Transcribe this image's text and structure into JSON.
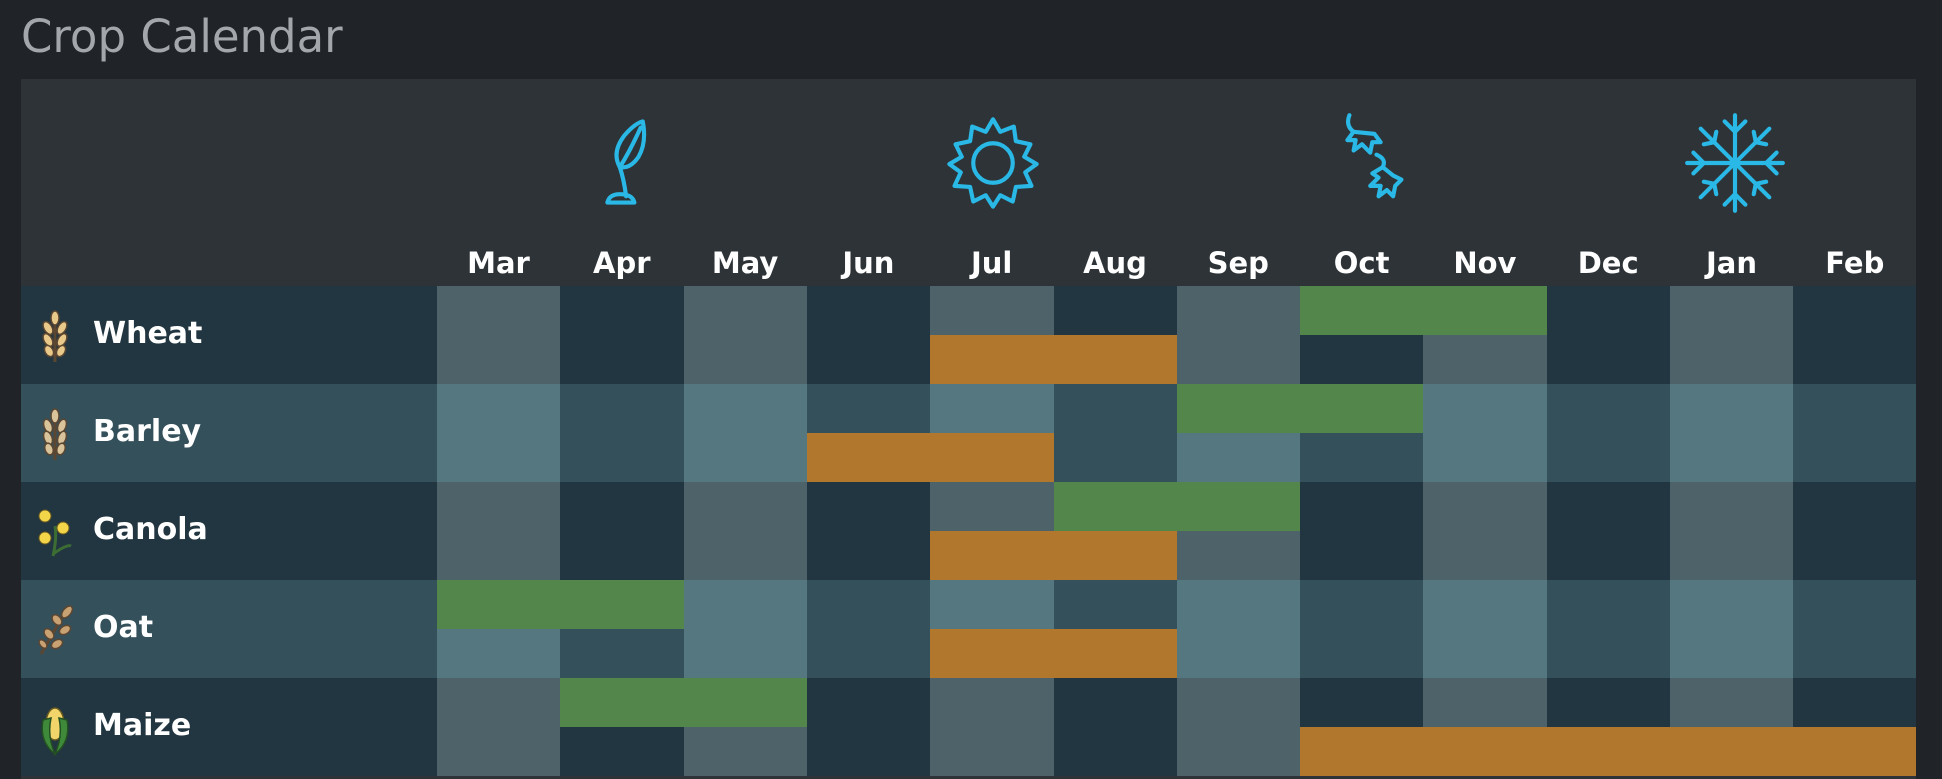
{
  "page": {
    "title": "Crop Calendar"
  },
  "colors": {
    "planting": "#52864b",
    "harvest": "#b0772d",
    "icon_accent": "#2ab8e6",
    "row_dark_base": "#213640",
    "row_dark_alt": "#4e6369",
    "row_light_base": "#34505b",
    "row_light_alt": "#557880"
  },
  "seasons": [
    {
      "name": "spring",
      "icon": "sprout-icon"
    },
    {
      "name": "summer",
      "icon": "sun-icon"
    },
    {
      "name": "autumn",
      "icon": "falling-leaves-icon"
    },
    {
      "name": "winter",
      "icon": "snowflake-icon"
    }
  ],
  "months": [
    "Mar",
    "Apr",
    "May",
    "Jun",
    "Jul",
    "Aug",
    "Sep",
    "Oct",
    "Nov",
    "Dec",
    "Jan",
    "Feb"
  ],
  "crops": [
    {
      "name": "Wheat",
      "icon": "wheat-icon",
      "planting": [
        "Oct",
        "Nov"
      ],
      "harvest": [
        "Jul",
        "Aug"
      ]
    },
    {
      "name": "Barley",
      "icon": "barley-icon",
      "planting": [
        "Sep",
        "Oct"
      ],
      "harvest": [
        "Jun",
        "Jul"
      ]
    },
    {
      "name": "Canola",
      "icon": "canola-icon",
      "planting": [
        "Aug",
        "Sep"
      ],
      "harvest": [
        "Jul",
        "Aug"
      ]
    },
    {
      "name": "Oat",
      "icon": "oat-icon",
      "planting": [
        "Mar",
        "Apr"
      ],
      "harvest": [
        "Jul",
        "Aug"
      ]
    },
    {
      "name": "Maize",
      "icon": "maize-icon",
      "planting": [
        "Apr",
        "May"
      ],
      "harvest": [
        "Oct",
        "Nov",
        "Dec",
        "Jan",
        "Feb"
      ]
    }
  ]
}
